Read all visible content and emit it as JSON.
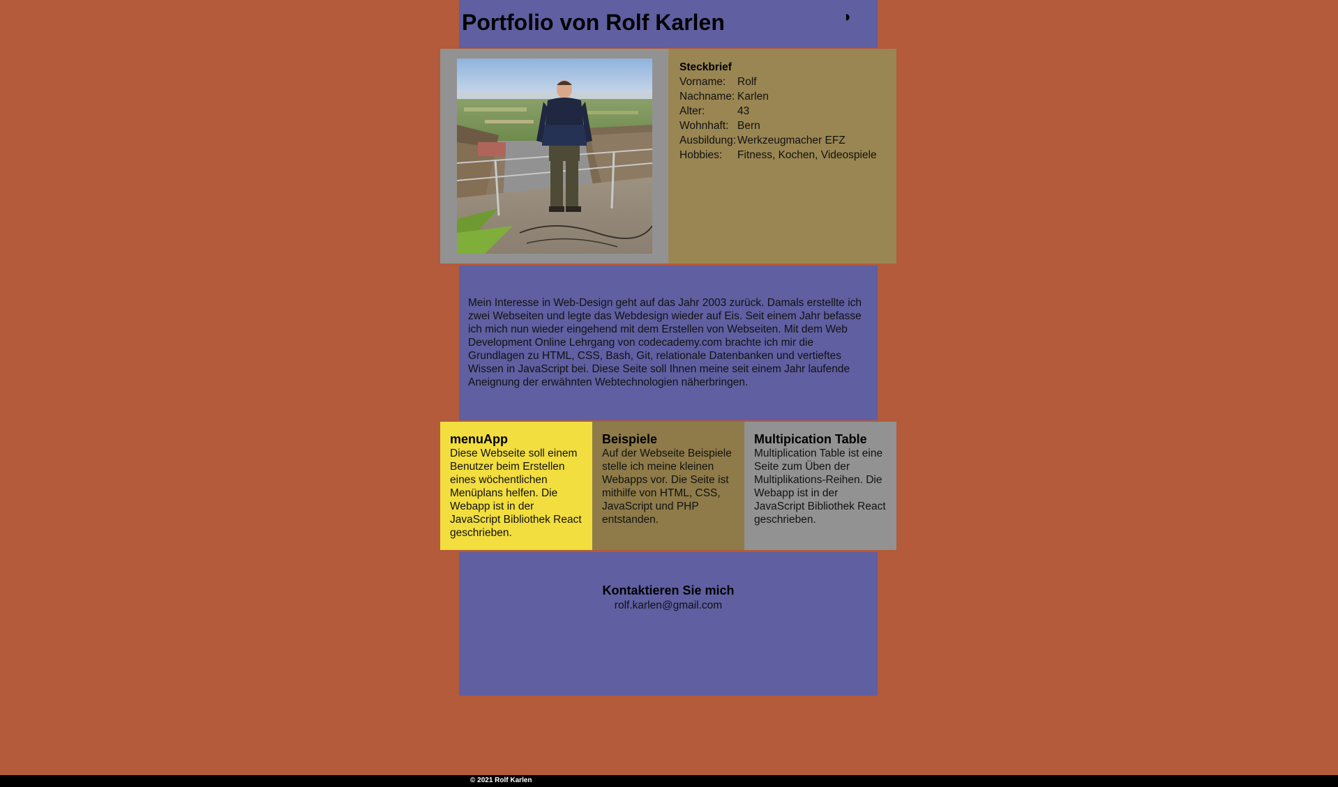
{
  "header": {
    "title": "Portfolio von Rolf Karlen",
    "theme_toggle_icon": "◑"
  },
  "profile": {
    "photo_icon": "portrait-photo",
    "steckbrief_title": "Steckbrief",
    "rows": [
      {
        "key": "Vorname:",
        "value": "Rolf"
      },
      {
        "key": "Nachname:",
        "value": "Karlen"
      },
      {
        "key": "Alter:",
        "value": "43"
      },
      {
        "key": "Wohnhaft:",
        "value": "Bern"
      },
      {
        "key": "Ausbildung:",
        "value": "Werkzeugmacher EFZ"
      },
      {
        "key": "Hobbies:",
        "value": "Fitness, Kochen, Videospiele"
      }
    ]
  },
  "about": {
    "text": "Mein Interesse in Web-Design geht auf das Jahr 2003 zurück. Damals erstellte ich zwei Webseiten und legte das Webdesign wieder auf Eis. Seit einem Jahr befasse ich mich nun wieder eingehend mit dem Erstellen von Webseiten. Mit dem Web Development Online Lehrgang von codecademy.com brachte ich mir die Grundlagen zu HTML, CSS, Bash, Git, relationale Datenbanken und vertieftes Wissen in JavaScript bei. Diese Seite soll Ihnen meine seit einem Jahr laufende Aneignung der erwähnten Webtechnologien näherbringen."
  },
  "projects": [
    {
      "title": "menuApp",
      "text": "Diese Webseite soll einem Benutzer beim Erstellen eines wöchentlichen Menüplans helfen. Die Webapp ist in der JavaScript Bibliothek React geschrieben."
    },
    {
      "title": "Beispiele",
      "text": "Auf der Webseite Beispiele stelle ich meine kleinen Webapps vor. Die Seite ist mithilfe von HTML, CSS, JavaScript und PHP entstanden."
    },
    {
      "title": "Multipication Table",
      "text": "Multiplication Table ist eine Seite zum Üben der Multiplikations-Reihen. Die Webapp ist in der JavaScript Bibliothek React geschrieben."
    }
  ],
  "contact": {
    "title": "Kontaktieren Sie mich",
    "email": "rolf.karlen@gmail.com"
  },
  "footer": {
    "copyright": "© 2021 Rolf Karlen"
  },
  "colors": {
    "page_background": "#b35b3a",
    "column_background": "#5f5fa2",
    "photo_panel": "#929292",
    "steckbrief_panel": "#9a8652",
    "project_menuapp": "#f2de3e",
    "project_beispiele": "#8e7b49",
    "project_multiplication": "#929292",
    "footer": "#000000"
  }
}
